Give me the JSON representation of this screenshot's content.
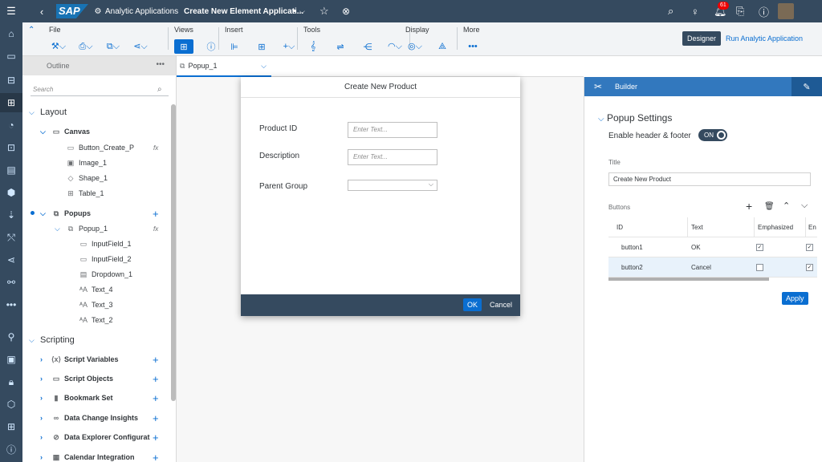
{
  "shell": {
    "logo": "SAP",
    "app_name": "Analytic Applications",
    "doc_title": "Create New Element Applicati...",
    "dirty_marker": "•",
    "notif_count": "61"
  },
  "toolbar": {
    "groups": [
      {
        "label": "File"
      },
      {
        "label": "Views"
      },
      {
        "label": "Insert"
      },
      {
        "label": "Tools"
      },
      {
        "label": "Display"
      },
      {
        "label": "More"
      }
    ],
    "designer_label": "Designer",
    "run_label": "Run Analytic Application"
  },
  "outline": {
    "title": "Outline",
    "search_placeholder": "Search",
    "sections": {
      "layout": "Layout",
      "scripting": "Scripting"
    },
    "canvas": {
      "label": "Canvas",
      "children": [
        "Button_Create_P",
        "Image_1",
        "Shape_1",
        "Table_1"
      ]
    },
    "popups": {
      "label": "Popups",
      "popup1": "Popup_1",
      "children": [
        "InputField_1",
        "InputField_2",
        "Dropdown_1",
        "Text_4",
        "Text_3",
        "Text_2"
      ]
    },
    "scripting_items": [
      "Script Variables",
      "Script Objects",
      "Bookmark Set",
      "Data Change Insights",
      "Data Explorer Configurat",
      "Calendar Integration"
    ]
  },
  "canvas_tab": {
    "label": "Popup_1"
  },
  "popup": {
    "title": "Create New Product",
    "fields": [
      {
        "label": "Product ID",
        "placeholder": "Enter Text..."
      },
      {
        "label": "Description",
        "placeholder": "Enter Text..."
      }
    ],
    "parent_group_label": "Parent Group",
    "ok_label": "OK",
    "cancel_label": "Cancel"
  },
  "builder": {
    "header": "Builder",
    "section_title": "Popup Settings",
    "enable_label": "Enable header & footer",
    "toggle_label": "ON",
    "title_label": "Title",
    "title_value": "Create New Product",
    "buttons_label": "Buttons",
    "columns": [
      "ID",
      "Text",
      "Emphasized",
      "En"
    ],
    "rows": [
      {
        "id": "button1",
        "text": "OK",
        "emphasized": true,
        "enabled": true
      },
      {
        "id": "button2",
        "text": "Cancel",
        "emphasized": false,
        "enabled": true
      }
    ],
    "apply_label": "Apply"
  },
  "colors": {
    "shell": "#354a5f",
    "accent": "#0a6ed1",
    "builder_header": "#3278be"
  }
}
